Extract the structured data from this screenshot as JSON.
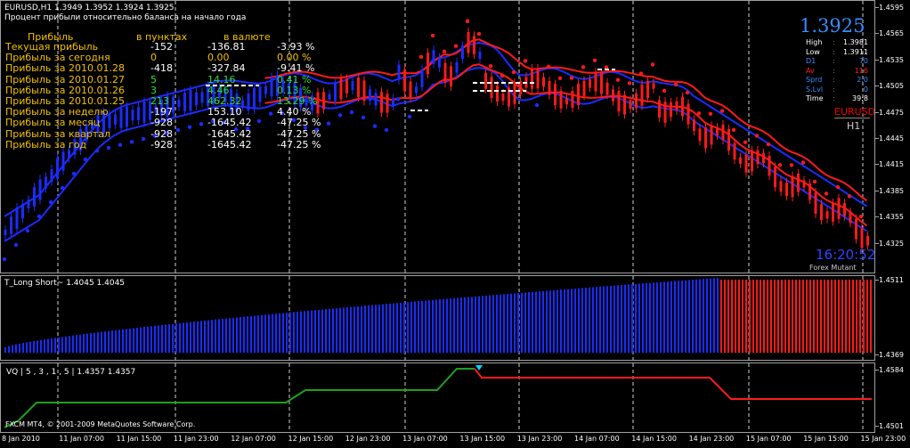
{
  "header": {
    "title_line": "EURUSD,H1  1.3949 1.3952 1.3924 1.3925",
    "subtitle": "Процент прибыли относительно баланса на начало года"
  },
  "profit_table": {
    "col_title": "Прибыль",
    "col_points": "в пунктах",
    "col_money": "в валюте",
    "rows": [
      {
        "label": "Текущая прибыль",
        "points": "-152",
        "money": "-136.81",
        "pct": "-3.93 %"
      },
      {
        "label": "Прибыль за сегодня",
        "points": "0",
        "money": "0.00",
        "pct": "0.00 %"
      },
      {
        "label": "Прибыль за 2010.01.28",
        "points": "-418",
        "money": "-327.84",
        "pct": "-9.41 %"
      },
      {
        "label": "Прибыль за 2010.01.27",
        "points": "5",
        "money": "14.16",
        "pct": "0.41 %"
      },
      {
        "label": "Прибыль за 2010.01.26",
        "points": "3",
        "money": "4.46",
        "pct": "0.13 %"
      },
      {
        "label": "Прибыль за 2010.01.25",
        "points": "213",
        "money": "462.32",
        "pct": "13.29 %"
      },
      {
        "label": "Прибыль за неделю",
        "points": "-197",
        "money": "153.10",
        "pct": "4.40 %"
      },
      {
        "label": "Прибыль за месяц",
        "points": "-928",
        "money": "-1645.42",
        "pct": "-47.25 %"
      },
      {
        "label": "Прибыль за квартал",
        "points": "-928",
        "money": "-1645.42",
        "pct": "-47.25 %"
      },
      {
        "label": "Прибыль за год",
        "points": "-928",
        "money": "-1645.42",
        "pct": "-47.25 %"
      }
    ]
  },
  "info_panel": {
    "price": "1.3925",
    "rows": [
      {
        "k": "High",
        "v": "1.3981",
        "color": "#ffffff"
      },
      {
        "k": "Low",
        "v": "1.3911",
        "color": "#ffffff"
      },
      {
        "k": "D1",
        "v": "70",
        "color": "#3a8cff"
      },
      {
        "k": "Av",
        "v": "116",
        "color": "#ff2020"
      },
      {
        "k": "Sprd",
        "v": "2.0",
        "color": "#3a8cff"
      },
      {
        "k": "S.Lvl",
        "v": "0",
        "color": "#3a8cff"
      },
      {
        "k": "Time",
        "v": "39:8",
        "color": "#ffffff"
      }
    ],
    "symbol": "EURUSD",
    "timeframe": "H1",
    "clock": "16:20:52",
    "brand": "Forex Mutant System"
  },
  "main_axis": [
    "1.4595",
    "1.4565",
    "1.4535",
    "1.4505",
    "1.4475",
    "1.4445",
    "1.4415",
    "1.4385",
    "1.4355",
    "1.4325"
  ],
  "long_short": {
    "label": "T_Long Short~ 1.4045 1.4045",
    "axis": [
      "1.4511",
      "1.4369"
    ]
  },
  "vq": {
    "label": "VQ | 5 , 3 , 1 , 5 | 1.4357 1.4357",
    "axis": [
      "1.4584",
      "1.4501"
    ]
  },
  "time_axis": [
    "8 Jan 2010",
    "11 Jan 07:00",
    "11 Jan 15:00",
    "11 Jan 23:00",
    "12 Jan 07:00",
    "12 Jan 15:00",
    "12 Jan 23:00",
    "13 Jan 07:00",
    "13 Jan 15:00",
    "13 Jan 23:00",
    "14 Jan 07:00",
    "14 Jan 15:00",
    "14 Jan 23:00",
    "15 Jan 07:00",
    "15 Jan 15:00",
    "15 Jan 23:00"
  ],
  "copyright": "FXCM MT4, © 2001-2009 MetaQuotes Software Corp.",
  "colors": {
    "bull": "#1a2cff",
    "bear": "#ff1a1a",
    "band_blue": "#1a2cff",
    "band_red": "#ff1a1a",
    "vq_green": "#1ea01e",
    "vq_red": "#ff1a1a",
    "arrow": "#00d8ff"
  }
}
